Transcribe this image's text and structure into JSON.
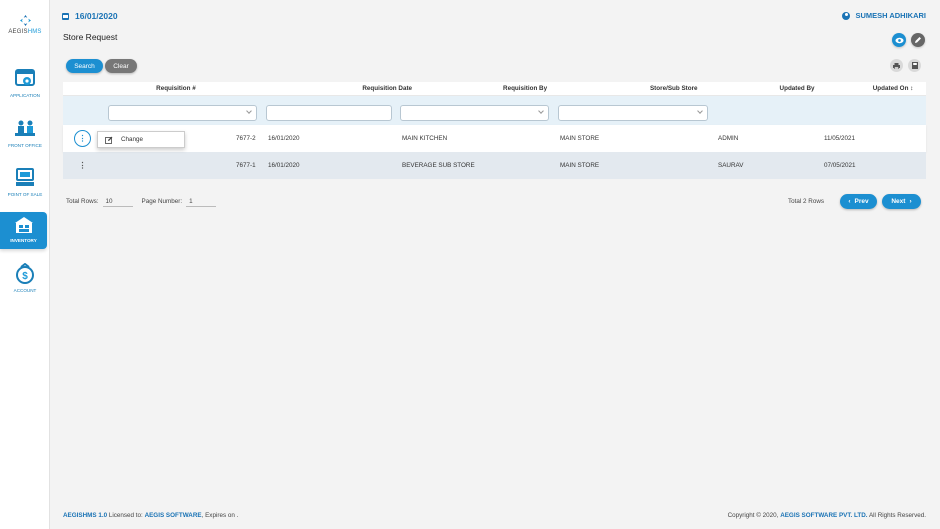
{
  "brand": {
    "name_prefix": "AEGIS",
    "name_suffix": "HMS"
  },
  "sidebar": {
    "items": [
      {
        "label": "APPLICATION",
        "icon": "gear-window-icon"
      },
      {
        "label": "FRONT OFFICE",
        "icon": "front-office-icon"
      },
      {
        "label": "POINT OF SALE",
        "icon": "pos-terminal-icon"
      },
      {
        "label": "INVENTORY",
        "icon": "warehouse-icon",
        "active": true
      },
      {
        "label": "ACCOUNT",
        "icon": "dollar-bag-icon"
      }
    ]
  },
  "header": {
    "date": "16/01/2020",
    "user": "SUMESH ADHIKARI"
  },
  "page": {
    "title": "Store Request"
  },
  "toolbar": {
    "search_label": "Search",
    "clear_label": "Clear"
  },
  "grid": {
    "columns": [
      "Requisition #",
      "Requisition Date",
      "Requisition By",
      "Store/Sub Store",
      "Updated By",
      "Updated On ↕"
    ],
    "rows": [
      {
        "req_no": "7677-2",
        "date": "16/01/2020",
        "by": "MAIN KITCHEN",
        "store": "MAIN STORE",
        "updated_by": "ADMIN",
        "updated_on": "11/05/2021"
      },
      {
        "req_no": "7677-1",
        "date": "16/01/2020",
        "by": "BEVERAGE SUB STORE",
        "store": "MAIN STORE",
        "updated_by": "SAURAV",
        "updated_on": "07/05/2021"
      }
    ],
    "kebab": "⋮",
    "context_menu": {
      "item_label": "Change"
    }
  },
  "pager": {
    "total_rows_label": "Total Rows:",
    "total_rows_value": "10",
    "page_number_label": "Page Number:",
    "page_number_value": "1",
    "summary": "Total 2 Rows",
    "prev_label": "Prev",
    "next_label": "Next"
  },
  "footer": {
    "version": "AEGISHMS 1.0",
    "licensed_to_label": " Licensed to: ",
    "licensee": "AEGIS SOFTWARE",
    "expires": ", Expires on .",
    "copyright_prefix": "Copyright © 2020, ",
    "company": "AEGIS SOFTWARE PVT. LTD.",
    "rights": " All Rights Reserved."
  },
  "colors": {
    "accent": "#1c8fd1",
    "brand_blue": "#1a73b5"
  }
}
